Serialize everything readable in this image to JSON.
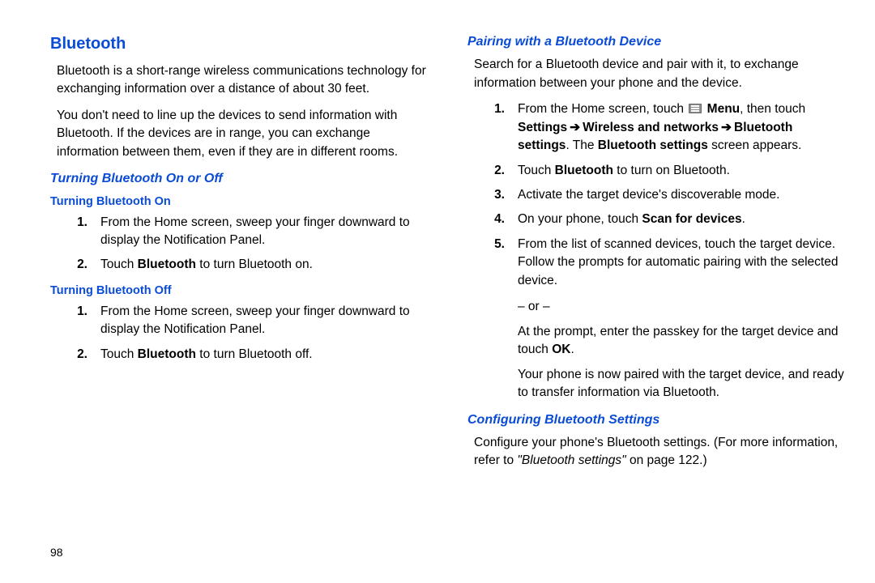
{
  "page_number": "98",
  "left": {
    "title": "Bluetooth",
    "intro1": "Bluetooth is a short-range wireless communications technology for exchanging information over a distance of about 30 feet.",
    "intro2": "You don't need to line up the devices to send information with Bluetooth. If the devices are in range, you can exchange information between them, even if they are in different rooms.",
    "sec1_title": "Turning Bluetooth On or Off",
    "sub_on_title": "Turning Bluetooth On",
    "on_steps": {
      "s1": {
        "num": "1.",
        "text": "From the Home screen, sweep your finger downward to display the Notification Panel."
      },
      "s2": {
        "num": "2.",
        "pre": "Touch ",
        "bold": "Bluetooth",
        "post": " to turn Bluetooth on."
      }
    },
    "sub_off_title": "Turning Bluetooth Off",
    "off_steps": {
      "s1": {
        "num": "1.",
        "text": "From the Home screen, sweep your finger downward to display the Notification Panel."
      },
      "s2": {
        "num": "2.",
        "pre": "Touch ",
        "bold": "Bluetooth",
        "post": " to turn Bluetooth off."
      }
    }
  },
  "right": {
    "sec_pair_title": "Pairing with a Bluetooth Device",
    "pair_intro": "Search for a Bluetooth device and pair with it, to exchange information between your phone and the device.",
    "pair_steps": {
      "s1": {
        "num": "1.",
        "pre": "From the Home screen, touch ",
        "menu_label": "Menu",
        "mid": ", then touch ",
        "path_settings": "Settings",
        "arrow": "➔",
        "path_wireless": "Wireless and networks",
        "path_bt": "Bluetooth settings",
        "tail1": ". The ",
        "tail_bold": "Bluetooth settings",
        "tail2": " screen appears."
      },
      "s2": {
        "num": "2.",
        "pre": "Touch ",
        "bold": "Bluetooth",
        "post": " to turn on Bluetooth."
      },
      "s3": {
        "num": "3.",
        "text": "Activate the target device's discoverable mode."
      },
      "s4": {
        "num": "4.",
        "pre": "On your phone, touch ",
        "bold": "Scan for devices",
        "post": "."
      },
      "s5": {
        "num": "5.",
        "text": "From the list of scanned devices, touch the target device. Follow the prompts for automatic pairing with the selected device."
      }
    },
    "or_text": "– or –",
    "prompt_pre": "At the prompt, enter the passkey for the target device and touch ",
    "prompt_bold": "OK",
    "prompt_post": ".",
    "paired_text": "Your phone is now paired with the target device, and ready to transfer information via Bluetooth.",
    "sec_config_title": "Configuring Bluetooth Settings",
    "config_pre": "Configure your phone's Bluetooth settings. (For more information, refer to ",
    "config_link": "\"Bluetooth settings\"",
    "config_post": " on page 122.)"
  }
}
